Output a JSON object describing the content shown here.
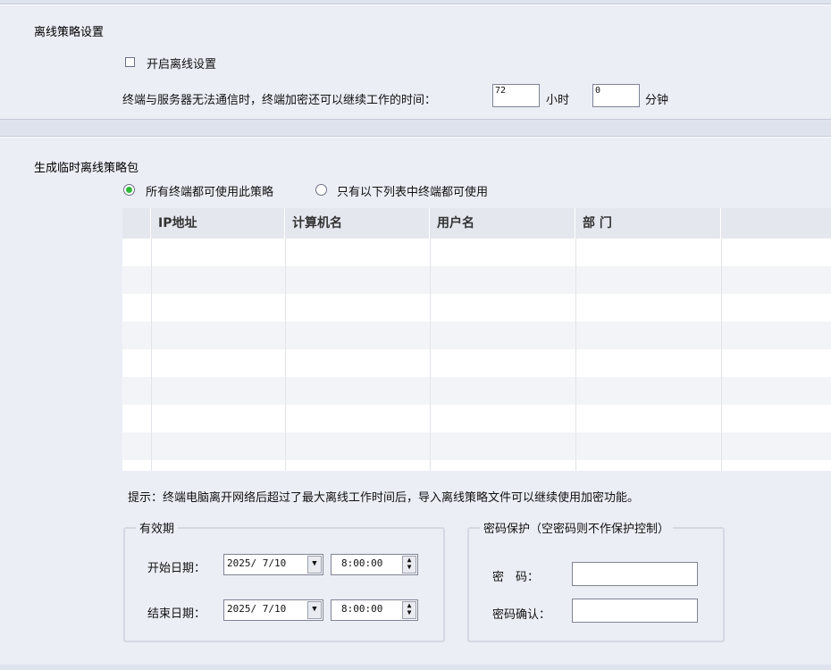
{
  "offline_policy": {
    "title": "离线策略设置",
    "enable_label": "开启离线设置",
    "enable_checked": false,
    "time_label": "终端与服务器无法通信时，终端加密还可以继续工作的时间：",
    "hours_value": "72",
    "hours_unit": "小时",
    "minutes_value": "0",
    "minutes_unit": "分钟"
  },
  "temp_package": {
    "title": "生成临时离线策略包",
    "scope_options": [
      {
        "label": "所有终端都可使用此策略",
        "selected": true
      },
      {
        "label": "只有以下列表中终端都可使用",
        "selected": false
      }
    ],
    "table": {
      "columns": [
        "IP地址",
        "计算机名",
        "用户名",
        "部 门"
      ],
      "rows": []
    },
    "hint": "提示：终端电脑离开网络后超过了最大离线工作时间后，导入离线策略文件可以继续使用加密功能。"
  },
  "validity": {
    "legend": "有效期",
    "start_label": "开始日期：",
    "start_date": "2025/ 7/10",
    "start_time": "8:00:00",
    "end_label": "结束日期：",
    "end_date": "2025/ 7/10",
    "end_time": "8:00:00"
  },
  "password": {
    "legend": "密码保护（空密码则不作保护控制）",
    "password_label": "密　码：",
    "confirm_label": "密码确认：",
    "password_value": "",
    "confirm_value": ""
  },
  "colors": {
    "radio_selected": "#2fb93a",
    "panel_bg": "#eceef6"
  }
}
